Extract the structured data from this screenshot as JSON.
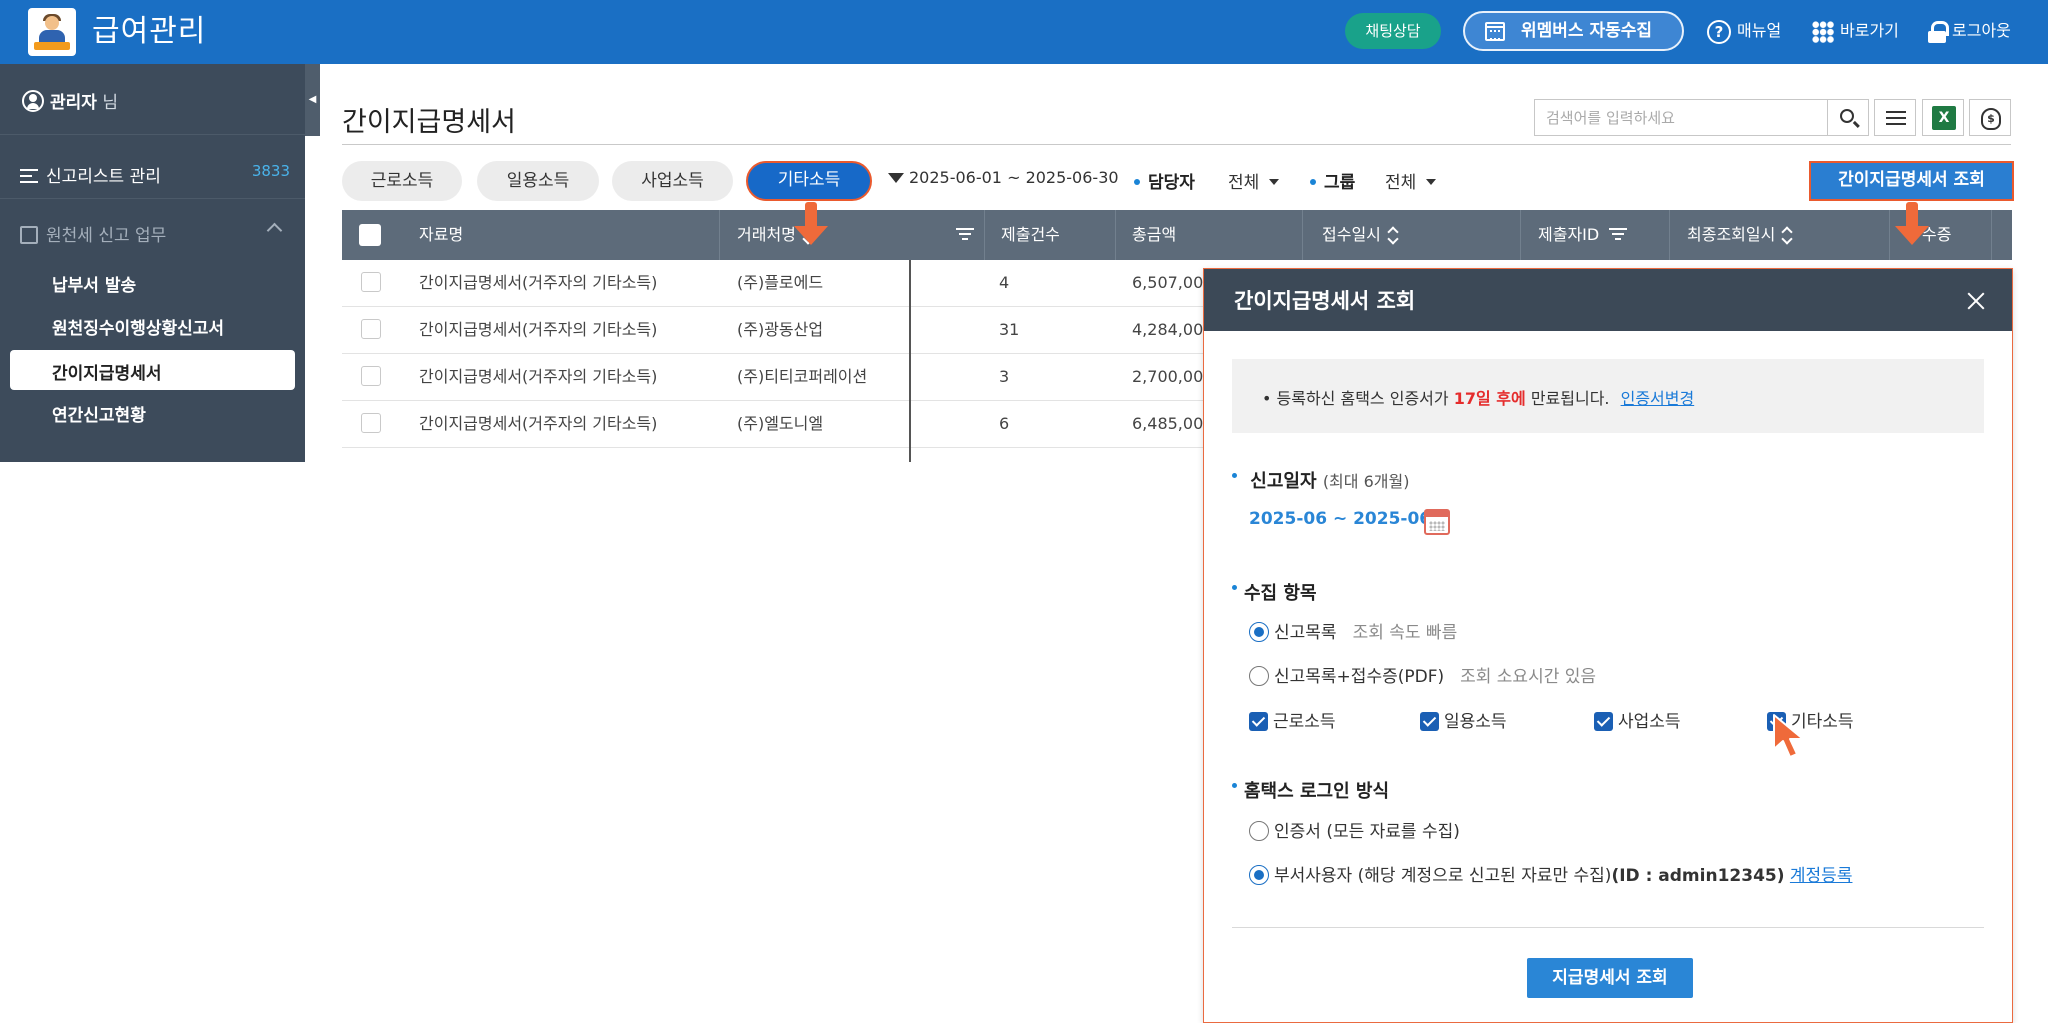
{
  "app": {
    "title": "급여관리"
  },
  "header": {
    "chat_label": "채팅상담",
    "wemembus_label": "위멤버스 자동수집",
    "manual_label": "매뉴얼",
    "goto_label": "바로가기",
    "logout_label": "로그아웃",
    "help_glyph": "?"
  },
  "sidebar": {
    "user_name": "관리자",
    "user_suffix": "님",
    "report_list_label": "신고리스트 관리",
    "report_list_count": "3833",
    "group_label": "원천세 신고 업무",
    "items": [
      {
        "label": "납부서 발송"
      },
      {
        "label": "원천징수이행상황신고서"
      },
      {
        "label": "간이지급명세서"
      },
      {
        "label": "연간신고현황"
      }
    ]
  },
  "main": {
    "page_title": "간이지급명세서",
    "search_placeholder": "검색어를 입력하세요",
    "excel_glyph": "X",
    "money_glyph": "$",
    "tabs": [
      {
        "label": "근로소득"
      },
      {
        "label": "일용소득"
      },
      {
        "label": "사업소득"
      },
      {
        "label": "기타소득"
      }
    ],
    "date_range": "2025-06-01 ~ 2025-06-30",
    "manager_label": "담당자",
    "manager_value": "전체",
    "group_filter_label": "그룹",
    "group_filter_value": "전체",
    "lookup_button": "간이지급명세서 조회"
  },
  "table": {
    "headers": {
      "name": "자료명",
      "client": "거래처명",
      "count": "제출건수",
      "total": "총금액",
      "received": "접수일시",
      "submitter": "제출자ID",
      "last_lookup": "최종조회일시",
      "receipt": "수증"
    },
    "rows": [
      {
        "name": "간이지급명세서(거주자의 기타소득)",
        "client": "(주)플로에드",
        "count": "4",
        "total": "6,507,00"
      },
      {
        "name": "간이지급명세서(거주자의 기타소득)",
        "client": "(주)광동산업",
        "count": "31",
        "total": "4,284,00"
      },
      {
        "name": "간이지급명세서(거주자의 기타소득)",
        "client": "(주)티티코퍼레이션",
        "count": "3",
        "total": "2,700,00"
      },
      {
        "name": "간이지급명세서(거주자의 기타소득)",
        "client": "(주)엘도니엘",
        "count": "6",
        "total": "6,485,00"
      }
    ]
  },
  "modal": {
    "title": "간이지급명세서 조회",
    "notice_prefix": "• 등록하신 홈택스 인증서가",
    "notice_days": "17일 후에",
    "notice_suffix": "만료됩니다.",
    "notice_link": "인증서변경",
    "report_date_label": "신고일자",
    "report_date_hint": "(최대 6개월)",
    "report_date_range": "2025-06 ~ 2025-06",
    "collect_label": "수집 항목",
    "collect_options": [
      {
        "label": "신고목록",
        "hint": "조회 속도 빠름",
        "selected": true
      },
      {
        "label": "신고목록+접수증(PDF)",
        "hint": "조회 소요시간 있음",
        "selected": false
      }
    ],
    "income_checks": [
      {
        "label": "근로소득",
        "checked": true
      },
      {
        "label": "일용소득",
        "checked": true
      },
      {
        "label": "사업소득",
        "checked": true
      },
      {
        "label": "기타소득",
        "checked": true
      }
    ],
    "login_label": "홈택스 로그인 방식",
    "login_options": [
      {
        "label": "인증서 (모든 자료를 수집)",
        "selected": false
      },
      {
        "label": "부서사용자 (해당 계정으로 신고된 자료만 수집)",
        "id_text": "(ID : admin12345)",
        "link": "계정등록",
        "selected": true
      }
    ],
    "submit_label": "지급명세서 조회"
  },
  "colors": {
    "header_blue": "#1a6fc4",
    "sidebar_bg": "#3d4b5b",
    "accent_orange": "#ea5a2e",
    "chat_green": "#19a28a",
    "warning_red": "#e52c2c"
  },
  "icons": [
    "logo-icon",
    "calendar-icon",
    "help-icon",
    "grid-icon",
    "lock-icon",
    "user-icon",
    "list-icon",
    "document-icon",
    "chevron-up-icon",
    "search-icon",
    "excel-icon",
    "moneybag-icon",
    "funnel-icon",
    "sort-icon",
    "close-icon",
    "cursor-icon"
  ]
}
